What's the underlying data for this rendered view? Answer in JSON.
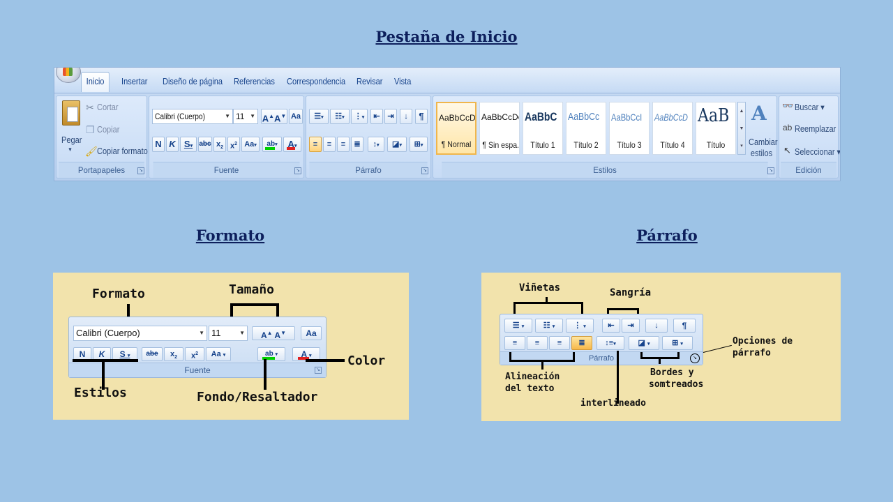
{
  "headings": {
    "main": "Pestaña de Inicio",
    "formato": "Formato",
    "parrafo": "Párrafo"
  },
  "ribbon": {
    "tabs": [
      "Inicio",
      "Insertar",
      "Diseño de página",
      "Referencias",
      "Correspondencia",
      "Revisar",
      "Vista"
    ],
    "groups": {
      "portapapeles": {
        "label": "Portapapeles",
        "pegar": "Pegar",
        "cortar": "Cortar",
        "copiar": "Copiar",
        "copiar_formato": "Copiar formato"
      },
      "fuente": {
        "label": "Fuente",
        "font_name": "Calibri (Cuerpo)",
        "font_size": "11",
        "bold": "N",
        "italic": "K",
        "underline": "S"
      },
      "parrafo": {
        "label": "Párrafo"
      },
      "estilos": {
        "label": "Estilos",
        "items": [
          {
            "sample": "AaBbCcDc",
            "name": "¶ Normal"
          },
          {
            "sample": "AaBbCcDc",
            "name": "¶ Sin espa..."
          },
          {
            "sample": "AaBbC",
            "name": "Título 1"
          },
          {
            "sample": "AaBbCc",
            "name": "Título 2"
          },
          {
            "sample": "AaBbCcI",
            "name": "Título 3"
          },
          {
            "sample": "AaBbCcD",
            "name": "Título 4"
          },
          {
            "sample": "AaB",
            "name": "Título"
          }
        ],
        "cambiar_estilos": "Cambiar estilos"
      },
      "edicion": {
        "label": "Edición",
        "buscar": "Buscar",
        "reemplazar": "Reemplazar",
        "seleccionar": "Seleccionar"
      }
    }
  },
  "formato_panel": {
    "font_name": "Calibri (Cuerpo)",
    "font_size": "11",
    "group_label": "Fuente",
    "labels": {
      "formato": "Formato",
      "tamano": "Tamaño",
      "color": "Color",
      "estilos": "Estilos",
      "fondo": "Fondo/Resaltador"
    }
  },
  "parrafo_panel": {
    "group_label": "Párrafo",
    "labels": {
      "vinetas": "Viñetas",
      "sangria": "Sangría",
      "opciones_1": "Opciones de",
      "opciones_2": "párrafo",
      "alineacion_1": "Alineación",
      "alineacion_2": "del texto",
      "bordes_1": "Bordes y",
      "bordes_2": "somtreados",
      "interlineado": "interlineado"
    }
  },
  "colors": {
    "background": "#9dc3e6",
    "heading": "#0d1f5c",
    "panel": "#f2e3ac",
    "highlight": "#00b050",
    "font_color": "#e02020"
  }
}
